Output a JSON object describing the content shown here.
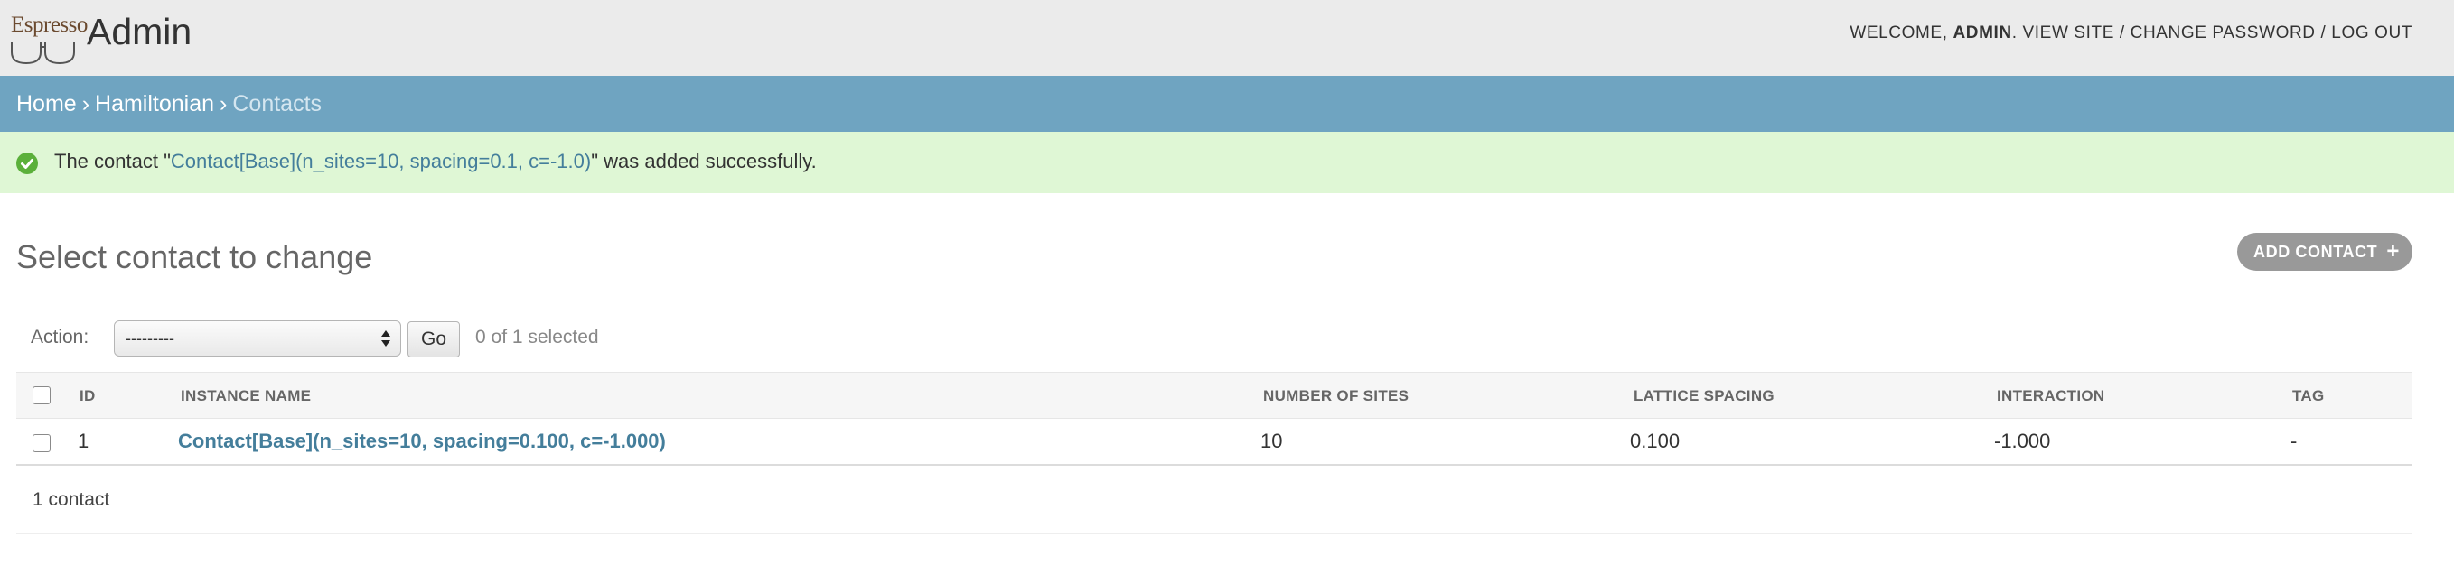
{
  "header": {
    "logo_text": "Espresso",
    "site_name": "Admin",
    "welcome_prefix": "WELCOME, ",
    "username": "ADMIN",
    "after_username": ". ",
    "view_site": "VIEW SITE",
    "separator": " / ",
    "change_password": "CHANGE PASSWORD",
    "log_out": "LOG OUT"
  },
  "breadcrumbs": {
    "home": "Home",
    "separator": "›",
    "app": "Hamiltonian",
    "current": "Contacts"
  },
  "message": {
    "icon": "check-circle-icon",
    "prefix": "The contact \"",
    "object_link": "Contact[Base](n_sites=10, spacing=0.1, c=-1.0)",
    "suffix": "\" was added successfully."
  },
  "content": {
    "title": "Select contact to change",
    "add_button": "ADD CONTACT",
    "add_icon": "plus-icon"
  },
  "actions": {
    "label": "Action:",
    "selected_option": "---------",
    "go_label": "Go",
    "selection_count": "0 of 1 selected"
  },
  "table": {
    "columns": [
      "ID",
      "INSTANCE NAME",
      "NUMBER OF SITES",
      "LATTICE SPACING",
      "INTERACTION",
      "TAG"
    ],
    "rows": [
      [
        "1",
        "Contact[Base](n_sites=10, spacing=0.100, c=-1.000)",
        "10",
        "0.100",
        "-1.000",
        "-"
      ]
    ]
  },
  "paginator": {
    "text": "1 contact"
  },
  "colors": {
    "header_bg": "#ebebeb",
    "breadcrumbs_bg": "#6fa4c1",
    "success_bg": "#dff7d5",
    "success_icon": "#5bb03b",
    "link": "#447e9b",
    "add_button_bg": "#999999"
  }
}
